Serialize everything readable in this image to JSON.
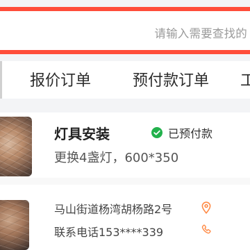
{
  "search": {
    "placeholder": "请输入需要查找的"
  },
  "tabs": [
    {
      "label": "报价订单"
    },
    {
      "label": "预付款订单"
    },
    {
      "label": "工"
    }
  ],
  "order": {
    "title": "灯具安装",
    "status": "已预付款",
    "description": "更换4盏灯，600*350",
    "address": "马山街道杨湾胡杨路2号",
    "phone": "联系电话153****339"
  },
  "colors": {
    "accent": "#ff4d3a",
    "success": "#22b14c",
    "icon": "#ff8a45"
  },
  "icons": {
    "status": "check-circle-icon",
    "location": "location-pin-icon",
    "phone": "phone-icon"
  }
}
